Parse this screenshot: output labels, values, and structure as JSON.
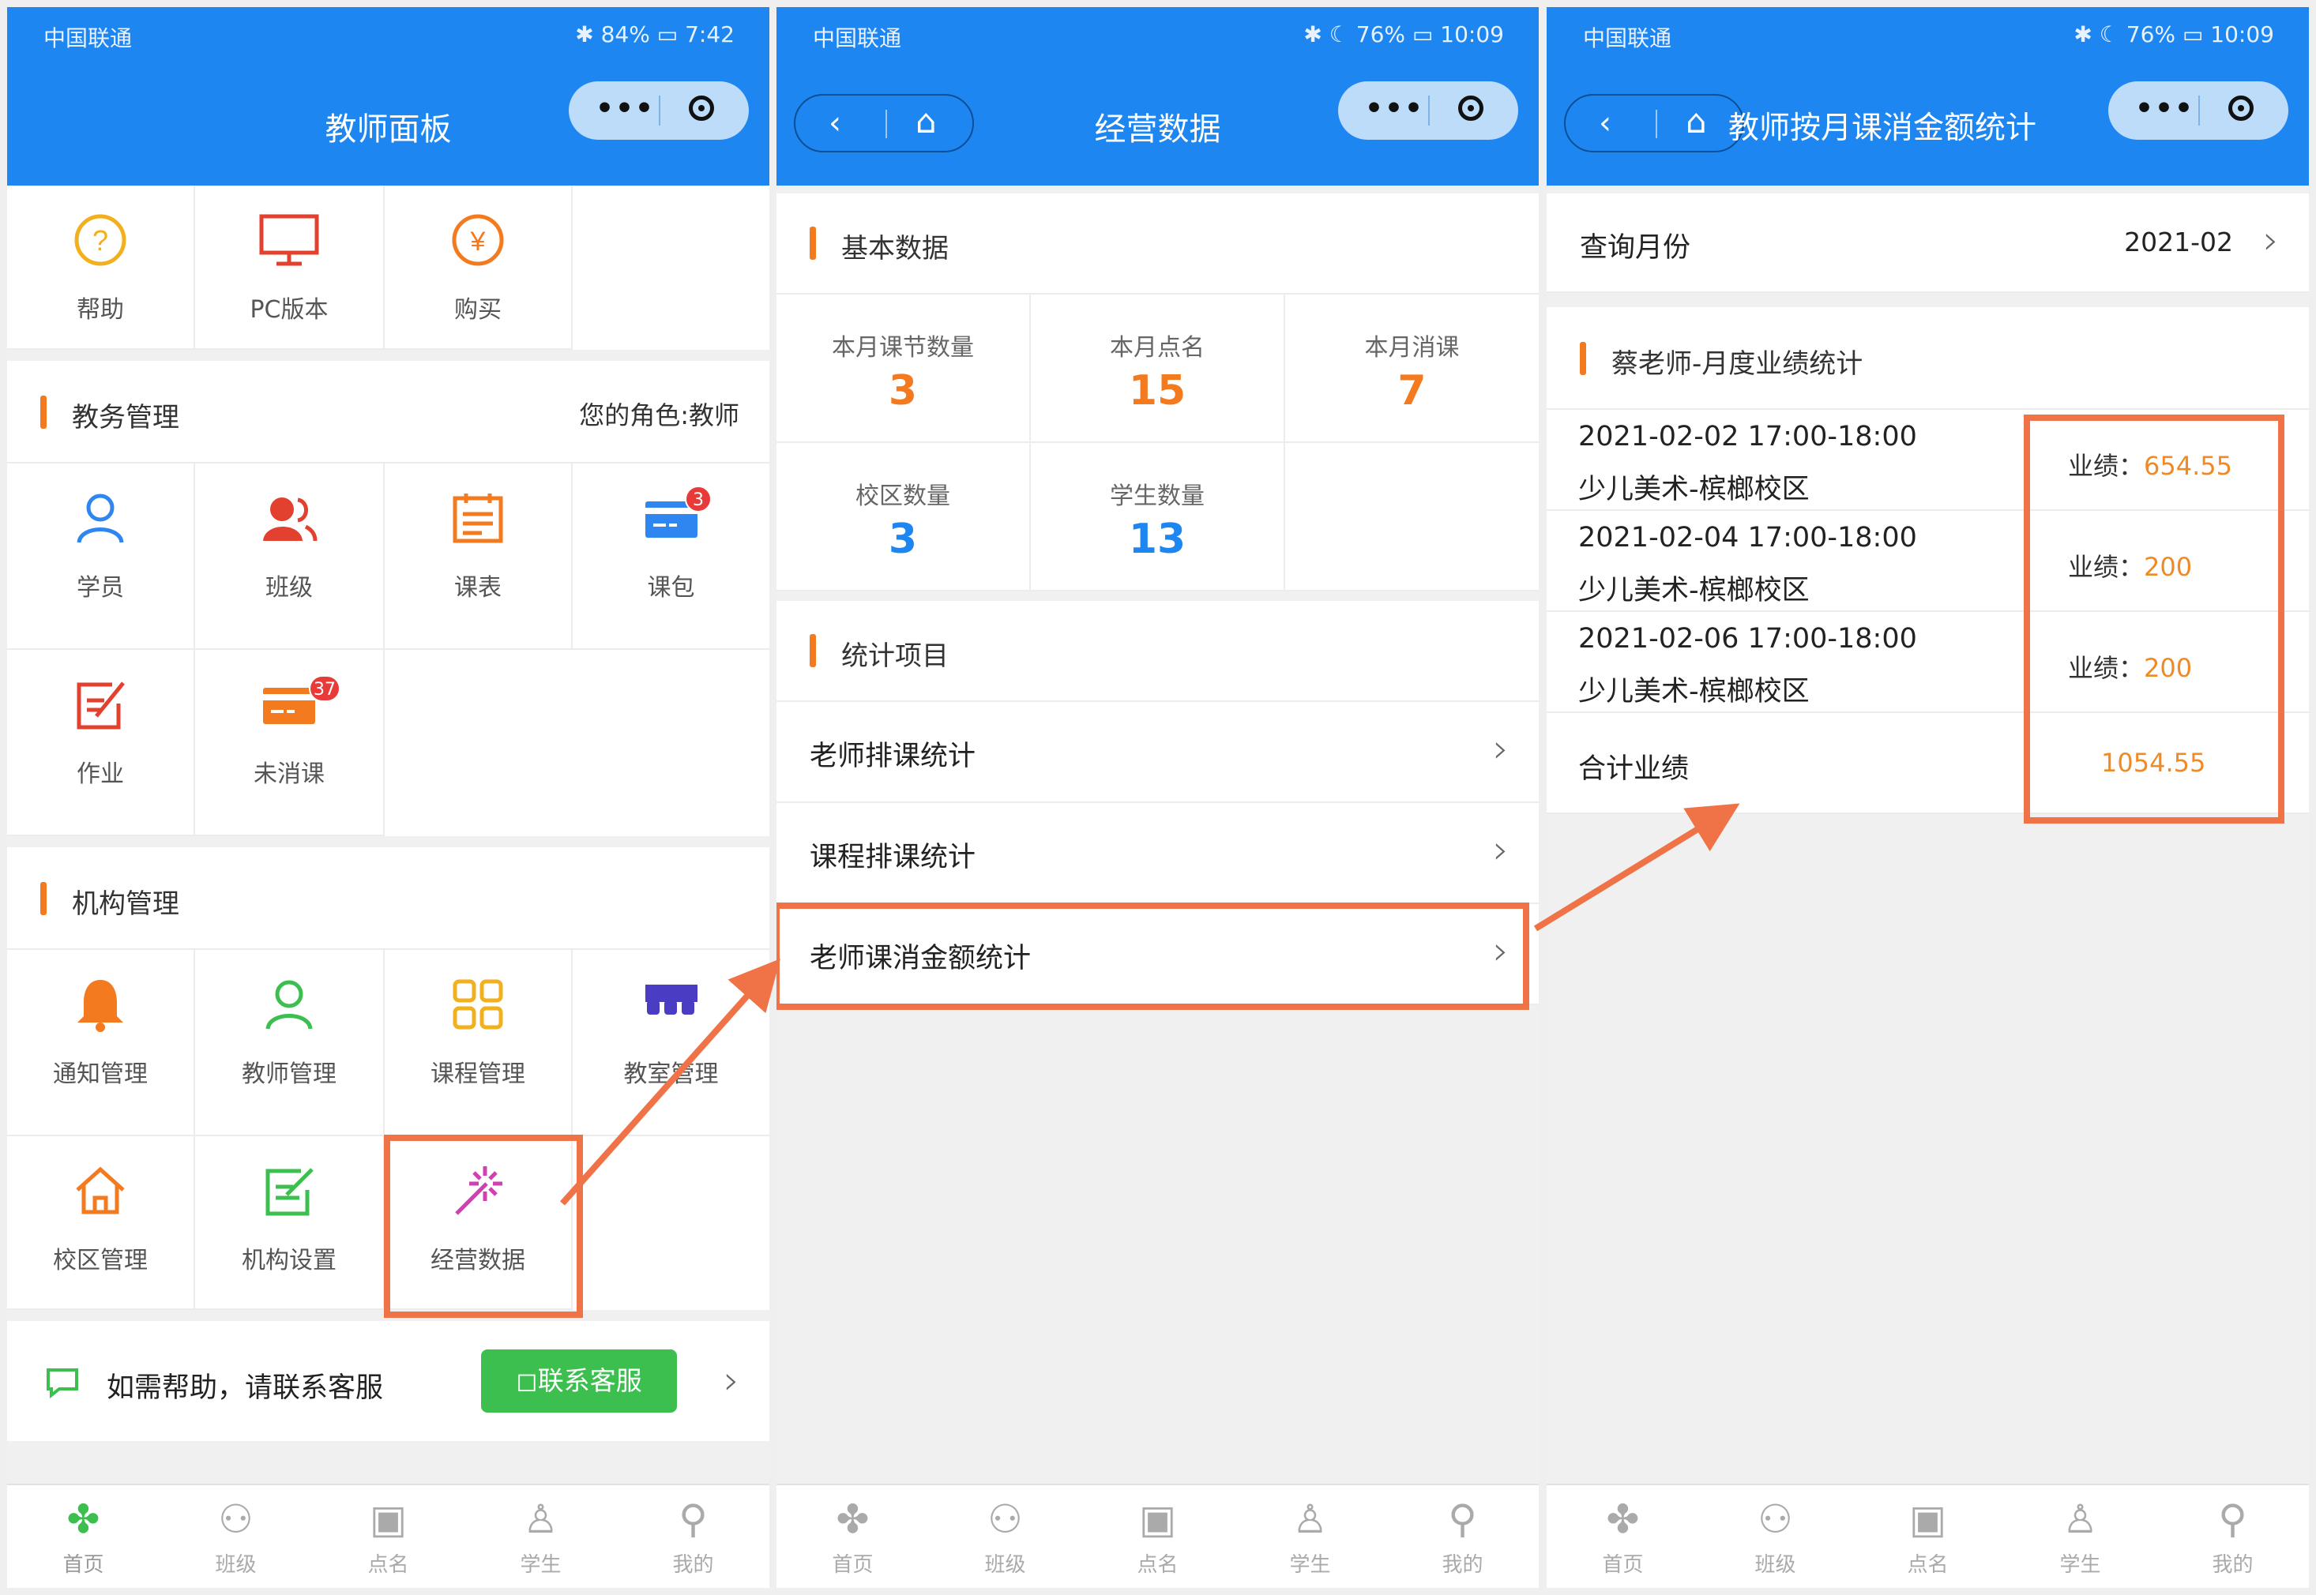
{
  "status": {
    "carrier": "中国联通",
    "s1": {
      "battery": "84%",
      "time": "7:42"
    },
    "s2": {
      "battery": "76%",
      "time": "10:09"
    },
    "s3": {
      "battery": "76%",
      "time": "10:09"
    }
  },
  "screen1": {
    "title": "教师面板",
    "top_items": [
      {
        "label": "帮助",
        "icon": "help-icon",
        "glyph": "?",
        "color": "#f2b01e"
      },
      {
        "label": "PC版本",
        "icon": "monitor-icon",
        "glyph": "🖵",
        "color": "#e3412f"
      },
      {
        "label": "购买",
        "icon": "yen-icon",
        "glyph": "¥",
        "color": "#f47a1f"
      }
    ],
    "section_academic": {
      "title": "教务管理",
      "role": "您的角色:教师"
    },
    "academic_items": [
      {
        "label": "学员",
        "icon": "user-icon",
        "glyph": "👤",
        "color": "#2f86f0"
      },
      {
        "label": "班级",
        "icon": "class-icon",
        "glyph": "👥",
        "color": "#e3412f"
      },
      {
        "label": "课表",
        "icon": "calendar-icon",
        "glyph": "▦",
        "color": "#f47a1f"
      },
      {
        "label": "课包",
        "icon": "card-icon",
        "glyph": "▬",
        "color": "#2f86f0",
        "badge": "3"
      },
      {
        "label": "作业",
        "icon": "edit-icon",
        "glyph": "✎",
        "color": "#e3412f"
      },
      {
        "label": "未消课",
        "icon": "card-icon",
        "glyph": "▬",
        "color": "#f47a1f",
        "badge": "37"
      }
    ],
    "section_org": {
      "title": "机构管理"
    },
    "org_items": [
      {
        "label": "通知管理",
        "icon": "bell-icon",
        "glyph": "🔔",
        "color": "#f47a1f"
      },
      {
        "label": "教师管理",
        "icon": "teacher-icon",
        "glyph": "👤",
        "color": "#3cbf4f"
      },
      {
        "label": "课程管理",
        "icon": "grid-icon",
        "glyph": "▦",
        "color": "#f2b01e"
      },
      {
        "label": "教室管理",
        "icon": "classroom-icon",
        "glyph": "▥",
        "color": "#4b3cc4"
      },
      {
        "label": "校区管理",
        "icon": "home-icon",
        "glyph": "⌂",
        "color": "#f47a1f"
      },
      {
        "label": "机构设置",
        "icon": "settings-edit-icon",
        "glyph": "✎",
        "color": "#3cbf4f"
      },
      {
        "label": "经营数据",
        "icon": "magic-wand-icon",
        "glyph": "✨",
        "color": "#d23fb0"
      }
    ],
    "help": {
      "text": "如需帮助，请联系客服",
      "button": "联系客服"
    }
  },
  "screen2": {
    "title": "经营数据",
    "basic_title": "基本数据",
    "stats": [
      {
        "label": "本月课节数量",
        "value": "3",
        "color": "#f47a1f"
      },
      {
        "label": "本月点名",
        "value": "15",
        "color": "#f47a1f"
      },
      {
        "label": "本月消课",
        "value": "7",
        "color": "#f47a1f"
      },
      {
        "label": "校区数量",
        "value": "3",
        "color": "#1e86f0"
      },
      {
        "label": "学生数量",
        "value": "13",
        "color": "#1e86f0"
      }
    ],
    "stat_items_title": "统计项目",
    "rows": [
      "老师排课统计",
      "课程排课统计",
      "老师课消金额统计"
    ]
  },
  "screen3": {
    "title": "教师按月课消金额统计",
    "query_label": "查询月份",
    "query_value": "2021-02",
    "section_title": "蔡老师-月度业绩统计",
    "perf_label": "业绩：",
    "records": [
      {
        "datetime": "2021-02-02 17:00-18:00",
        "course": "少儿美术-槟榔校区",
        "amount": "654.55"
      },
      {
        "datetime": "2021-02-04 17:00-18:00",
        "course": "少儿美术-槟榔校区",
        "amount": "200"
      },
      {
        "datetime": "2021-02-06 17:00-18:00",
        "course": "少儿美术-槟榔校区",
        "amount": "200"
      }
    ],
    "total_label": "合计业绩",
    "total_value": "1054.55"
  },
  "tabbar": [
    {
      "label": "首页",
      "icon": "home-grid-icon"
    },
    {
      "label": "班级",
      "icon": "class-grid-icon"
    },
    {
      "label": "点名",
      "icon": "rollcall-icon"
    },
    {
      "label": "学生",
      "icon": "student-icon"
    },
    {
      "label": "我的",
      "icon": "mine-icon"
    }
  ],
  "colors": {
    "nav_blue": "#1e86f0",
    "accent_orange": "#f47a1f",
    "highlight": "#f07247",
    "green": "#3cbf4f"
  }
}
